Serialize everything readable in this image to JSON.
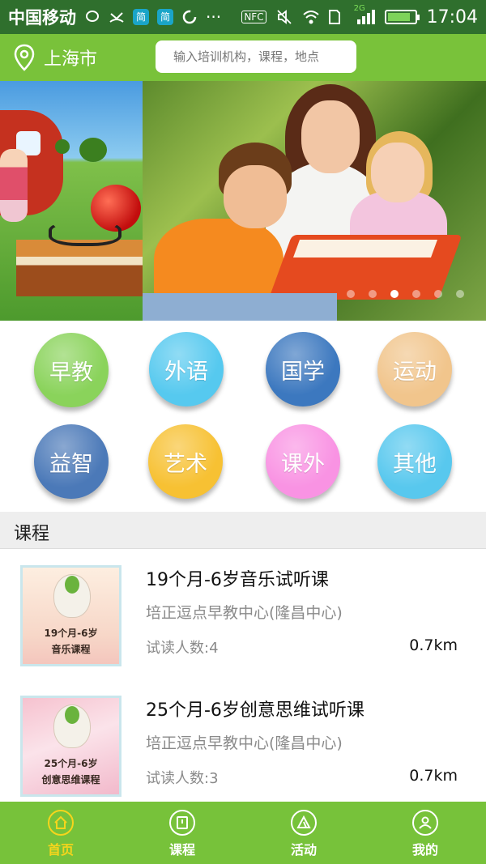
{
  "status_bar": {
    "carrier": "中国移动",
    "badge1": "简",
    "badge2": "简",
    "nfc": "NFC",
    "network": "2G",
    "time": "17:04",
    "battery_level": 0.85,
    "icons": [
      "message-icon",
      "missed-call-icon",
      "sync-icon",
      "more-dots-icon",
      "mute-icon",
      "wifi-icon",
      "sim-icon",
      "signal-icon",
      "battery-icon"
    ]
  },
  "header": {
    "city": "上海市",
    "location_icon": "location-pin-icon",
    "search_placeholder": "输入培训机构，课程，地点"
  },
  "banner": {
    "slide_count": 6,
    "active_index": 2
  },
  "categories": [
    {
      "label": "早教",
      "color": "#8ad35b"
    },
    {
      "label": "外语",
      "color": "#56c9ef"
    },
    {
      "label": "国学",
      "color": "#3c78bf"
    },
    {
      "label": "运动",
      "color": "#f1c58c"
    },
    {
      "label": "益智",
      "color": "#4b79b8"
    },
    {
      "label": "艺术",
      "color": "#f7c133"
    },
    {
      "label": "课外",
      "color": "#f993e3"
    },
    {
      "label": "其他",
      "color": "#58c8ee"
    }
  ],
  "section": {
    "title": "课程"
  },
  "courses": [
    {
      "title": "19个月-6岁音乐试听课",
      "org": "培正逗点早教中心(隆昌中心)",
      "count": "试读人数:4",
      "distance": "0.7km",
      "thumb_line1": "19个月-6岁",
      "thumb_line2": "音乐课程"
    },
    {
      "title": "25个月-6岁创意思维试听课",
      "org": "培正逗点早教中心(隆昌中心)",
      "count": "试读人数:3",
      "distance": "0.7km",
      "thumb_line1": "25个月-6岁",
      "thumb_line2": "创意思维课程"
    }
  ],
  "bottom_nav": [
    {
      "label": "首页",
      "icon": "home-icon",
      "active": true
    },
    {
      "label": "课程",
      "icon": "book-icon",
      "active": false
    },
    {
      "label": "活动",
      "icon": "tent-icon",
      "active": false
    },
    {
      "label": "我的",
      "icon": "user-icon",
      "active": false
    }
  ],
  "colors": {
    "status_bar": "#2f6f2d",
    "header": "#79c23a",
    "nav_active": "#f6d51c"
  }
}
